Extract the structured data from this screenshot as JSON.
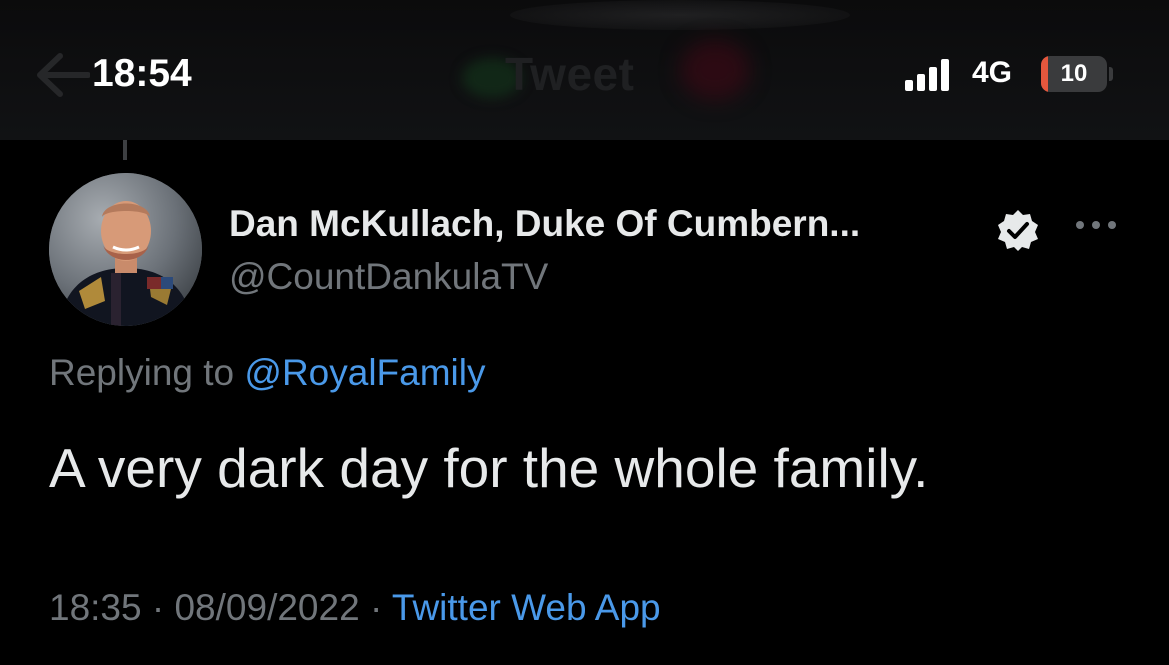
{
  "status_bar": {
    "time": "18:54",
    "network": "4G",
    "battery_level": "10",
    "battery_fraction": 0.1,
    "battery_color": "#e4573d",
    "signal_bars_active": 4
  },
  "header": {
    "title": "Tweet",
    "back_icon": "back-arrow-icon"
  },
  "tweet": {
    "author": {
      "display_name": "Dan McKullach, Duke Of Cumbern...",
      "handle": "@CountDankulaTV",
      "verified": true,
      "avatar_icon": "avatar-photo"
    },
    "more_icon": "more-options-icon",
    "replying_prefix": "Replying to ",
    "replying_to": "@RoyalFamily",
    "text": "A very dark day for the whole family.",
    "time": "18:35",
    "separator": " · ",
    "date": "08/09/2022",
    "source": "Twitter Web App"
  },
  "colors": {
    "background": "#000000",
    "primary_text": "#e7e9ea",
    "secondary_text": "#71767b",
    "link": "#4a99e9"
  }
}
